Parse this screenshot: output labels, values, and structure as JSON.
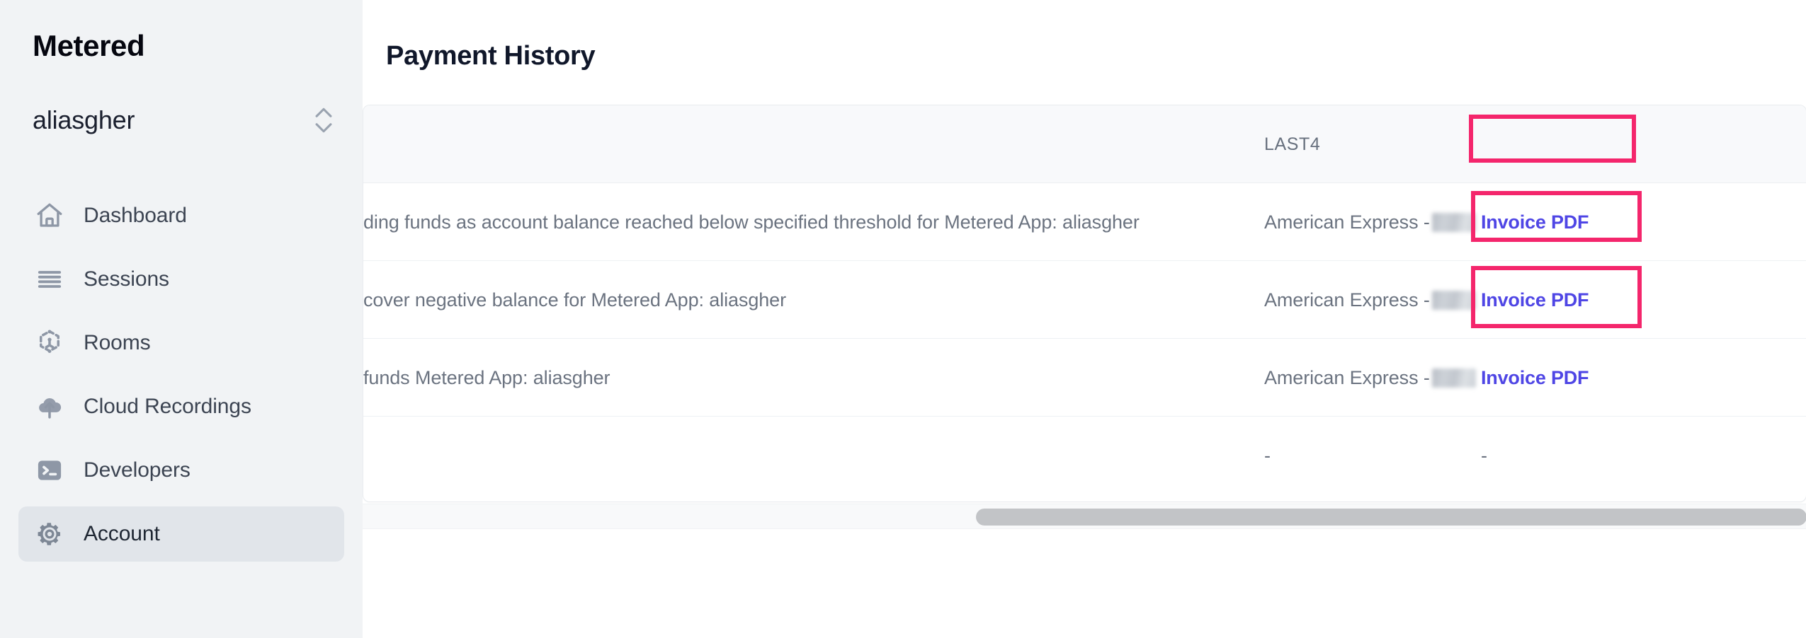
{
  "sidebar": {
    "brand": "Metered",
    "account_selector": {
      "name": "aliasgher",
      "icon": "chevron-up-down-icon"
    },
    "items": [
      {
        "label": "Dashboard",
        "icon": "home-icon",
        "active": false
      },
      {
        "label": "Sessions",
        "icon": "list-icon",
        "active": false
      },
      {
        "label": "Rooms",
        "icon": "rooms-node-icon",
        "active": false
      },
      {
        "label": "Cloud Recordings",
        "icon": "cloud-upload-icon",
        "active": false
      },
      {
        "label": "Developers",
        "icon": "terminal-icon",
        "active": false
      },
      {
        "label": "Account",
        "icon": "gear-icon",
        "active": true
      }
    ]
  },
  "main": {
    "page_title": "Payment History",
    "table": {
      "columns": [
        "LAST4",
        ""
      ],
      "headers": {
        "last4": "LAST4"
      },
      "rows": [
        {
          "description": "ding funds as account balance reached below specified threshold for Metered App: aliasgher",
          "last4_brand": "American Express - ",
          "last4_masked": true,
          "action_label": "Invoice PDF",
          "highlighted": true
        },
        {
          "description": "cover negative balance for Metered App: aliasgher",
          "last4_brand": "American Express - ",
          "last4_masked": true,
          "action_label": "Invoice PDF",
          "highlighted": true
        },
        {
          "description": "funds Metered App: aliasgher",
          "last4_brand": "American Express - ",
          "last4_masked": true,
          "action_label": "Invoice PDF",
          "highlighted": true
        },
        {
          "description": "",
          "last4_brand": "-",
          "last4_masked": false,
          "action_label": "-",
          "highlighted": false
        }
      ]
    },
    "scrollbar": {
      "orientation": "horizontal"
    }
  },
  "colors": {
    "sidebar_bg": "#f1f3f5",
    "sidebar_active_bg": "#e1e5ea",
    "link_indigo": "#4f46e5",
    "highlight_pink": "#f4266c",
    "table_header_bg": "#f8f9fb",
    "text_muted": "#6b7380"
  }
}
